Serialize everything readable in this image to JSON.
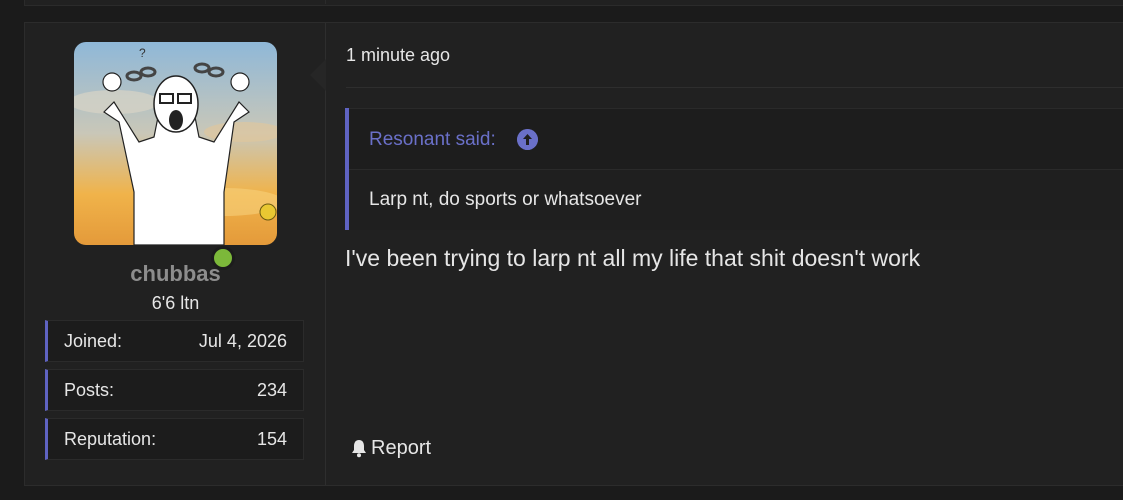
{
  "post": {
    "user": {
      "username": "chubbas",
      "title": "6'6 ltn",
      "online": true,
      "avatar_icon": "soyjak-breaking-chains-avatar",
      "stats": [
        {
          "label": "Joined:",
          "value": "Jul 4, 2026"
        },
        {
          "label": "Posts:",
          "value": "234"
        },
        {
          "label": "Reputation:",
          "value": "154"
        }
      ]
    },
    "timestamp": "1 minute ago",
    "quote": {
      "author_label": "Resonant said:",
      "jump_icon": "arrow-up-circle-icon",
      "text": "Larp nt, do sports or whatsoever"
    },
    "message": "I've been trying to larp nt all my life that shit doesn't work",
    "actions": {
      "report_label": "Report",
      "report_icon": "bell-icon"
    }
  },
  "colors": {
    "background": "#1b1b1b",
    "panel": "#212121",
    "accent": "#5f63c2",
    "link": "#6a70c8",
    "online": "#7cb83a",
    "username": "#8d8d8d"
  }
}
